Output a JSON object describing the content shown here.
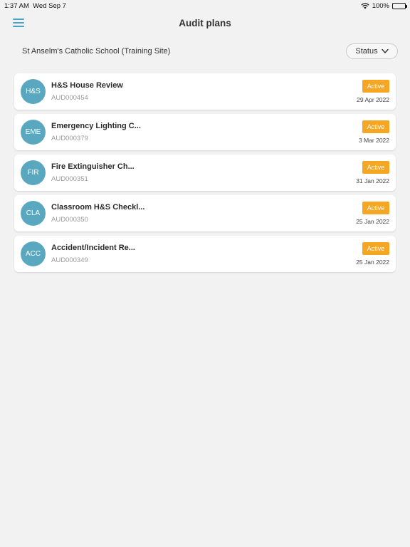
{
  "status_bar": {
    "time": "1:37 AM",
    "date": "Wed Sep 7",
    "battery": "100%"
  },
  "header": {
    "title": "Audit plans",
    "menu_icon": "hamburger-menu-icon"
  },
  "site": {
    "name": "St Anselm's Catholic School (Training Site)"
  },
  "filter": {
    "label": "Status"
  },
  "colors": {
    "accent": "#4aa3c4",
    "avatar": "#5aa8bf",
    "badge": "#f5a623",
    "background": "#f2f2f2"
  },
  "audits": [
    {
      "initials": "H&S",
      "title": "H&S House Review",
      "code": "AUD000454",
      "status": "Active",
      "date": "29 Apr 2022"
    },
    {
      "initials": "EME",
      "title": "Emergency Lighting C...",
      "code": "AUD000379",
      "status": "Active",
      "date": "3 Mar 2022"
    },
    {
      "initials": "FIR",
      "title": "Fire Extinguisher Ch...",
      "code": "AUD000351",
      "status": "Active",
      "date": "31 Jan 2022"
    },
    {
      "initials": "CLA",
      "title": "Classroom H&S Checkl...",
      "code": "AUD000350",
      "status": "Active",
      "date": "25 Jan 2022"
    },
    {
      "initials": "ACC",
      "title": "Accident/Incident Re...",
      "code": "AUD000349",
      "status": "Active",
      "date": "25 Jan 2022"
    }
  ]
}
